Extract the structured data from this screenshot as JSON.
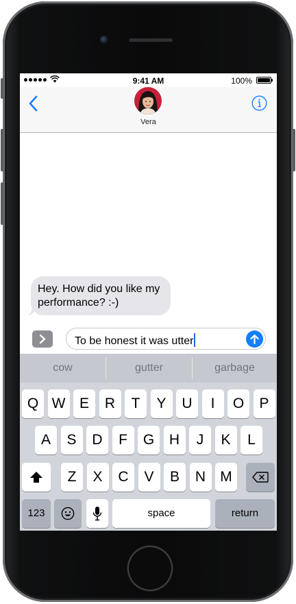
{
  "status_bar": {
    "time": "9:41 AM",
    "battery_label": "100%"
  },
  "nav": {
    "contact_name": "Vera"
  },
  "messages": [
    {
      "line1": "Hey. How did you like my",
      "line2": "performance? :-)"
    }
  ],
  "compose": {
    "text": "To be honest it was utter"
  },
  "suggestions": [
    "cow",
    "gutter",
    "garbage"
  ],
  "keyboard": {
    "row1": [
      "Q",
      "W",
      "E",
      "R",
      "T",
      "Y",
      "U",
      "I",
      "O",
      "P"
    ],
    "row2": [
      "A",
      "S",
      "D",
      "F",
      "G",
      "H",
      "J",
      "K",
      "L"
    ],
    "row3": [
      "Z",
      "X",
      "C",
      "V",
      "B",
      "N",
      "M"
    ],
    "numbers_label": "123",
    "space_label": "space",
    "return_label": "return"
  },
  "colors": {
    "accent": "#147efb",
    "bubble_gray": "#e5e5ea",
    "keyboard_bg": "#d1d5db"
  },
  "icons": [
    "back-chevron-icon",
    "info-icon",
    "apps-chevron-icon",
    "send-arrow-icon",
    "shift-icon",
    "delete-icon",
    "emoji-icon",
    "mic-icon"
  ]
}
